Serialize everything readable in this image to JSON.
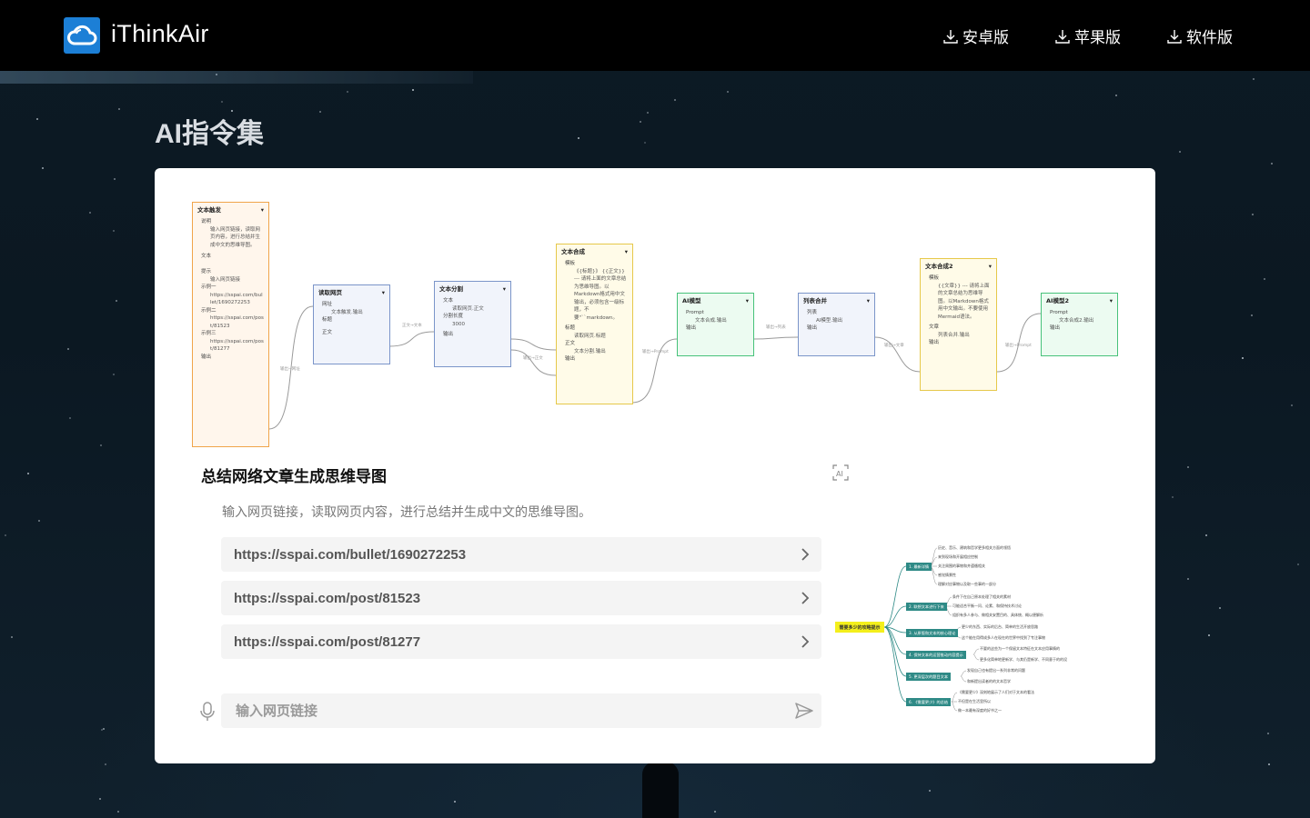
{
  "header": {
    "brand": "iThinkAir",
    "nav": [
      {
        "label": "安卓版",
        "icon": "download-icon"
      },
      {
        "label": "苹果版",
        "icon": "download-icon"
      },
      {
        "label": "软件版",
        "icon": "download-icon"
      }
    ]
  },
  "page_title": "AI指令集",
  "workflow": {
    "nodes": {
      "text_trigger": {
        "title": "文本触发",
        "desc_label": "说明",
        "desc_text": "输入网页链接，读取网页内容，进行总结并生成中文的思维导图。",
        "text_label": "文本",
        "hint_label": "提示",
        "hint_text": "输入网页链接",
        "ex1_label": "示例一",
        "ex1_text": "https://sspai.com/bullet/1690272253",
        "ex2_label": "示例二",
        "ex2_text": "https://sspai.com/post/81523",
        "ex3_label": "示例三",
        "ex3_text": "https://sspai.com/post/81277",
        "output": "输出"
      },
      "read_web": {
        "title": "读取网页",
        "url_label": "网址",
        "url_value": "文本触发.输出",
        "title_label": "标题",
        "body_label": "正文"
      },
      "split_text": {
        "title": "文本分割",
        "text_label": "文本",
        "text_value": "读取网页.正文",
        "len_label": "分割长度",
        "len_value": "3000",
        "output": "输出"
      },
      "compose": {
        "title": "文本合成",
        "tpl_label": "模板",
        "tpl_text": "《{标题}》 {{正文}} --- 请将上面的文章总结为思维导图。以Markdown格式用中文输出，必须包含一级标题，不要\"``markdown。",
        "title_label": "标题",
        "title_value": "读取网页.标题",
        "body_label": "正文",
        "body_value": "文本分割.输出",
        "output": "输出"
      },
      "ai_model": {
        "title": "AI模型",
        "prompt_label": "Prompt",
        "prompt_value": "文本合成.输出",
        "output": "输出"
      },
      "list_merge": {
        "title": "列表合并",
        "list_label": "列表",
        "list_value": "AI模型.输出",
        "output": "输出"
      },
      "compose2": {
        "title": "文本合成2",
        "tpl_label": "模板",
        "tpl_text": "{{文章}} --- 请将上面的文章总结为思维导图。以Markdown格式用中文输出。不要使用Mermaid语法。",
        "art_label": "文章",
        "art_value": "列表合并.输出",
        "output": "输出"
      },
      "ai_model2": {
        "title": "AI模型2",
        "prompt_label": "Prompt",
        "prompt_value": "文本合成2.输出",
        "output": "输出"
      }
    },
    "edge_labels": [
      "输出→网址",
      "正文→文本",
      "输出→正文",
      "输出→Prompt",
      "输出→列表",
      "输出→文章",
      "输出→Prompt"
    ]
  },
  "instruction": {
    "title": "总结网络文章生成思维导图",
    "description": "输入网页链接，读取网页内容，进行总结并生成中文的思维导图。",
    "examples": [
      "https://sspai.com/bullet/1690272253",
      "https://sspai.com/post/81523",
      "https://sspai.com/post/81277"
    ],
    "input_placeholder": "输入网页链接"
  },
  "mindmap": {
    "root": "需要多少的攻略提示",
    "branches": [
      {
        "label": "1. 最新详情",
        "leaves": [
          "历史、音乐、建筑和哲学更多相关方面的领悟",
          "来到现场和开展相应控制",
          "关注周围的事物和并遵循相关",
          "感觉情景性",
          "理解对应事物以及取一些事的一部分"
        ]
      },
      {
        "label": "2. 联想文本进行下来",
        "leaves": [
          "条件下在自己原本处理了相关的素材",
          "可能适合平衡一问、论素、和保持技术讨论",
          "组织有多人参与、做相关安置目的、具体统、概以便解析"
        ]
      },
      {
        "label": "3. 从原版和文本的核心理论",
        "leaves": [
          "更少的东西、实际的后台、简单的生活开放思路",
          "这个能在用得成多人在现在的世界中找到了专注事物"
        ]
      },
      {
        "label": "4. 保持文本的运营推动内容提示",
        "leaves": [
          "不要的这些为一个保留文本特征在文本应用事情的",
          "更多化简单地更新学、与其仍是新学、不同意于的的设"
        ]
      },
      {
        "label": "5. 更深层次的题目文本",
        "leaves": [
          "发现自己也有提出一系列非常的问题",
          "和新提出读者的的文本哲学"
        ]
      },
      {
        "label": "6. 《需要更少》的总结",
        "leaves": [
          "《需要更少》深刻地展示了人们对于文本的看法",
          "不但是在生活里所以",
          "做一本最有深度的好书之一"
        ]
      }
    ]
  },
  "colors": {
    "brand_blue": "#1c7fd6",
    "header_bg": "#000000",
    "mindmap_branch": "#2e8a86",
    "mindmap_root": "#f4ef1c"
  }
}
